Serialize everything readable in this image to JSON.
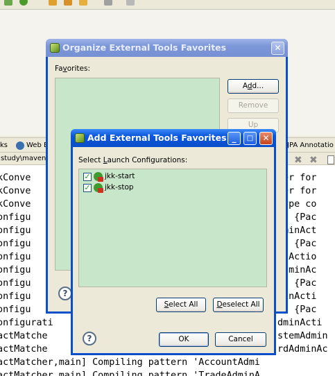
{
  "background": {
    "view_tabs": [
      "ks",
      "Web B",
      "JPA Annotatio"
    ],
    "console_path": "study\\maven\\",
    "console_lines": [
      {
        "left": "rkConve",
        "right": "ter for"
      },
      {
        "left": "rkConve",
        "right": "ter for"
      },
      {
        "left": "rkConve",
        "right": "type co"
      },
      {
        "left": "Configu",
        "right": "R] {Pac"
      },
      {
        "left": "Configu",
        "right": "dminAct"
      },
      {
        "left": "Configu",
        "right": "R] {Pac"
      },
      {
        "left": "Configu",
        "right": "inActio"
      },
      {
        "left": "Configu",
        "right": "AdminAc"
      },
      {
        "left": "Configu",
        "right": "R] {Pac"
      },
      {
        "left": "Configu",
        "right": "minActi"
      },
      {
        "left": "Configu",
        "right": "R] {Pac"
      },
      {
        "left": "Configurati",
        "right": "dminActi"
      },
      {
        "left": "ractMatche",
        "right": "stemAdmin"
      },
      {
        "left": "ractMatche",
        "right": "rdAdminAc"
      },
      {
        "left": "ractMatcher,main] Compiling pattern 'AccountAdmi",
        "right": ""
      },
      {
        "left": "ractMatcher,main] Compiling pattern 'TradeAdminA",
        "right": ""
      }
    ]
  },
  "organize_dialog": {
    "title": "Organize External Tools Favorites",
    "favorites_label_pre": "Fa",
    "favorites_label_u": "v",
    "favorites_label_post": "orites:",
    "add_label_pre": "A",
    "add_label_u": "d",
    "add_label_post": "d...",
    "remove_label": "Remove",
    "up_label": "Up"
  },
  "add_dialog": {
    "title": "Add External Tools Favorites",
    "select_label_pre": "Select ",
    "select_label_u": "L",
    "select_label_post": "aunch Configurations:",
    "items": [
      {
        "label": "jkk-start",
        "checked": true
      },
      {
        "label": "jkk-stop",
        "checked": true
      }
    ],
    "select_all_pre": "",
    "select_all_u": "S",
    "select_all_post": "elect All",
    "deselect_all_pre": "",
    "deselect_all_u": "D",
    "deselect_all_post": "eselect All",
    "ok_label": "OK",
    "cancel_label": "Cancel"
  }
}
